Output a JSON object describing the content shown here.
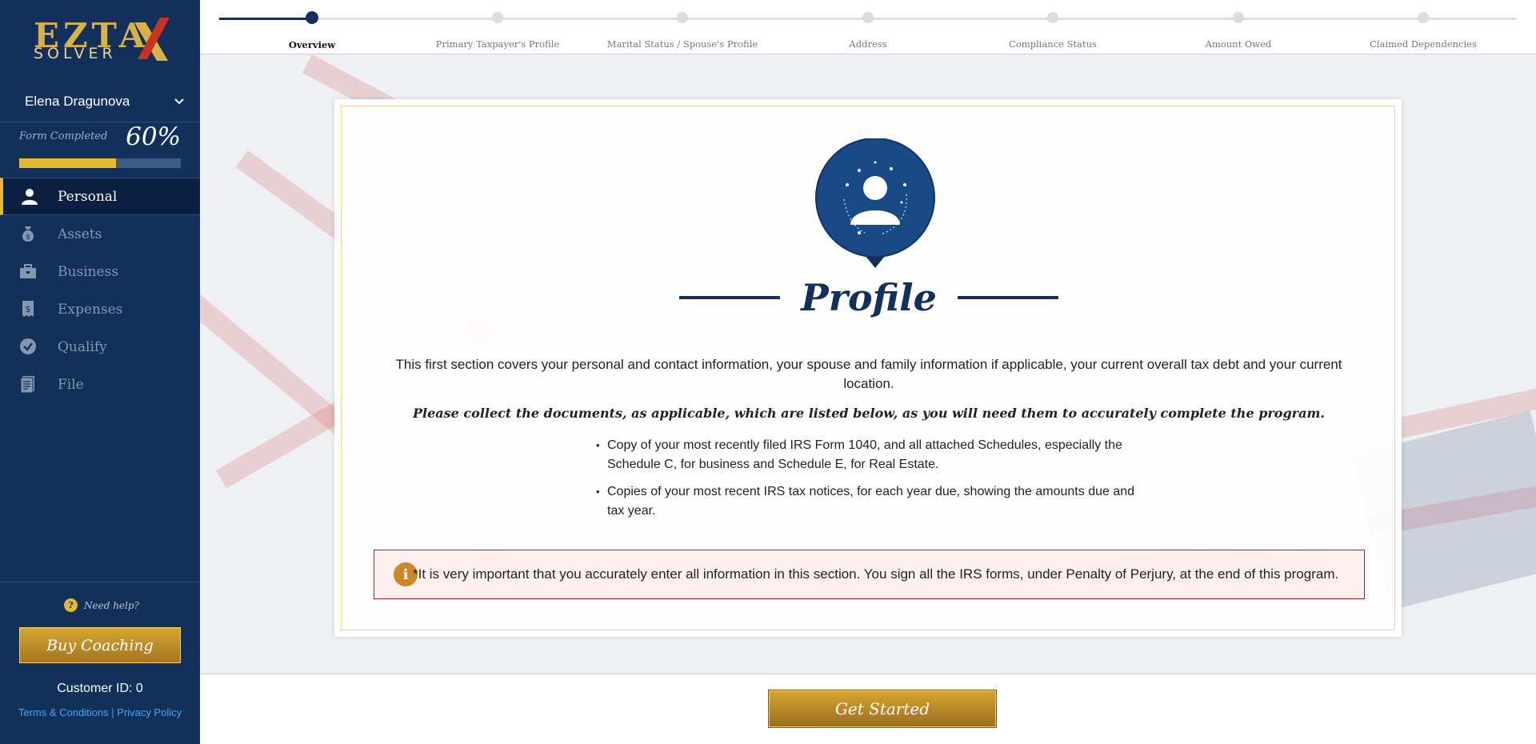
{
  "brand": {
    "logo_main": "EZTA",
    "logo_sub": "SOLVER"
  },
  "user": {
    "name": "Elena Dragunova"
  },
  "progress": {
    "label": "Form Completed",
    "percent_text": "60%",
    "fraction": 0.6
  },
  "nav": {
    "items": [
      {
        "label": "Personal",
        "icon": "person-icon",
        "active": true
      },
      {
        "label": "Assets",
        "icon": "money-bag-icon"
      },
      {
        "label": "Business",
        "icon": "briefcase-icon"
      },
      {
        "label": "Expenses",
        "icon": "receipt-icon"
      },
      {
        "label": "Qualify",
        "icon": "check-circle-icon"
      },
      {
        "label": "File",
        "icon": "document-icon"
      }
    ]
  },
  "sidebar_bottom": {
    "help": "Need help?",
    "buy_coaching": "Buy Coaching",
    "customer_id": "Customer ID: 0",
    "terms": "Terms & Conditions",
    "separator": " | ",
    "privacy": "Privacy Policy"
  },
  "steps": [
    {
      "label": "Overview",
      "active": true
    },
    {
      "label": "Primary Taxpayer's Profile"
    },
    {
      "label": "Marital Status / Spouse's Profile"
    },
    {
      "label": "Address"
    },
    {
      "label": "Compliance Status"
    },
    {
      "label": "Amount Owed"
    },
    {
      "label": "Claimed Dependencies"
    }
  ],
  "main": {
    "title": "Profile",
    "intro": "This first section covers your personal and contact information, your spouse and family information if applicable, your current overall tax debt and your current location.",
    "notice": "Please collect the documents, as applicable, which are listed below, as you will need them to accurately complete the program.",
    "documents": [
      "Copy of your most recently filed IRS Form 1040, and all attached Schedules, especially the Schedule C, for business and Schedule E, for Real Estate.",
      "Copies of your most recent IRS tax notices, for each year due, showing the amounts due and tax year."
    ],
    "warning": "*It is very important that you accurately enter all information in this section. You sign all the IRS forms, under Penalty of Perjury, at the end of this program."
  },
  "footer": {
    "get_started": "Get Started"
  },
  "colors": {
    "navy": "#12305a",
    "gold": "#e6b735",
    "warning_border": "#a3222d"
  }
}
